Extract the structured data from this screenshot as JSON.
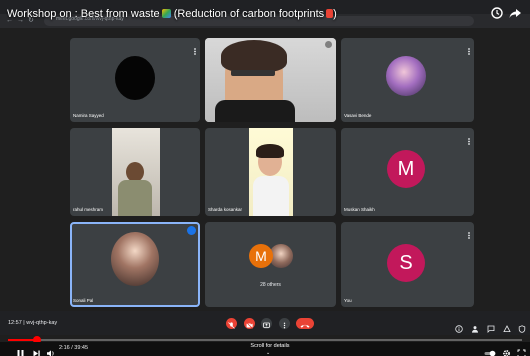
{
  "video": {
    "title": "Workshop on : Best from waste",
    "title_suffix": "(Reduction of carbon footprints",
    "title_close": ")"
  },
  "browser": {
    "url": "meet.google.com/wvj-qthp-kay"
  },
  "participants": [
    {
      "name": "Namira Sayyed",
      "type": "avatar-black"
    },
    {
      "name": "",
      "type": "video"
    },
    {
      "name": "Vasavi Bende",
      "type": "photo-circle"
    },
    {
      "name": "rahul meshram",
      "type": "video"
    },
    {
      "name": "Sharda kosankar",
      "type": "video"
    },
    {
      "name": "Muskan Shaikh",
      "type": "avatar",
      "initial": "M",
      "color": "#c2185b"
    },
    {
      "name": "Sonali Pal",
      "type": "photo-circle"
    },
    {
      "name": "",
      "type": "group",
      "initial": "M",
      "color": "#e8710a",
      "label": "28 others"
    },
    {
      "name": "You",
      "type": "avatar",
      "initial": "S",
      "color": "#c2185b"
    }
  ],
  "meeting": {
    "time": "12:57",
    "separator": "|",
    "code": "wvj-qthp-kay"
  },
  "player": {
    "time": "2:16 / 39:45",
    "scroll_hint": "Scroll for details",
    "progress": 0.057
  },
  "colors": {
    "tile": "#3c4043",
    "accent": "#8ab4f8",
    "end_call": "#ea4335",
    "yt_red": "#ff0000"
  }
}
